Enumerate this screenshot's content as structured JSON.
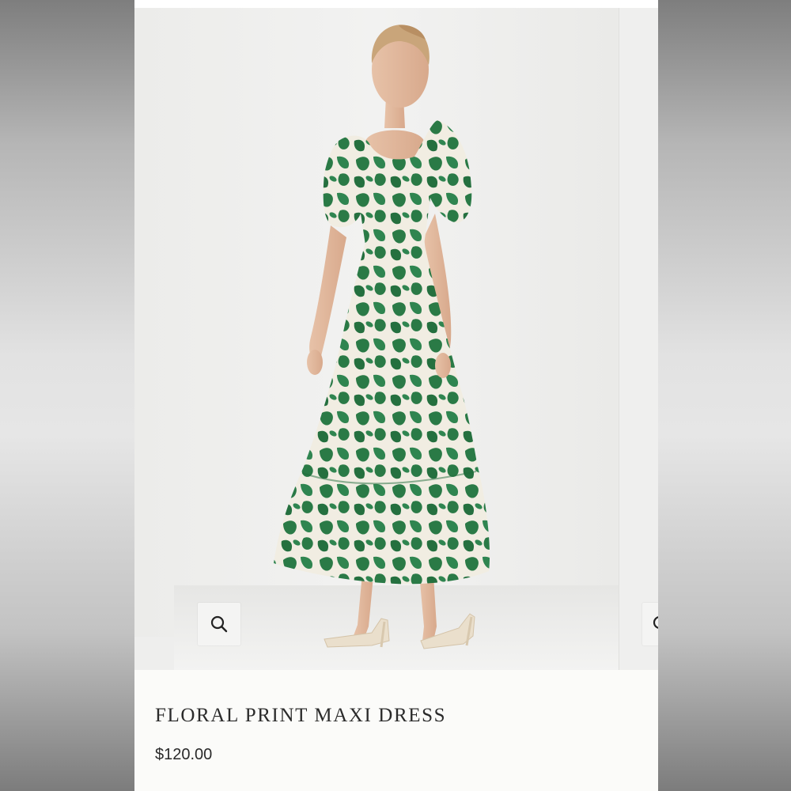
{
  "product": {
    "title": "FLORAL PRINT MAXI DRESS",
    "price": "$120.00",
    "image_description_icon": "model-photo"
  },
  "gallery": {
    "zoom_icon": "search-icon"
  },
  "colors": {
    "dress_green": "#2a7a46",
    "dress_cream": "#f1ede2",
    "text_dark": "#2b2b2b",
    "background": "#fbfbf9"
  }
}
